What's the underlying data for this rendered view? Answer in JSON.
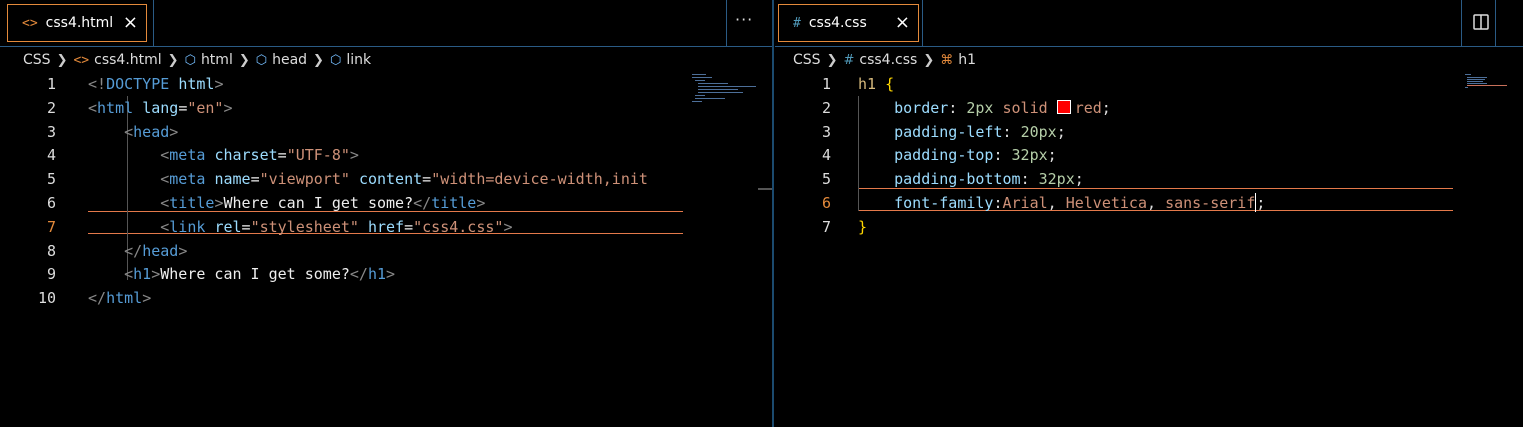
{
  "left": {
    "tab": {
      "icon": "<>",
      "label": "css4.html",
      "close": "×"
    },
    "more": "···",
    "breadcrumb": {
      "folder": "CSS",
      "file": "css4.html",
      "path": [
        "html",
        "head",
        "link"
      ]
    },
    "lines": [
      {
        "n": "1",
        "segs": [
          [
            "p",
            "<!"
          ],
          [
            "tag",
            "DOCTYPE"
          ],
          [
            "t",
            " "
          ],
          [
            "attr",
            "html"
          ],
          [
            "p",
            ">"
          ]
        ]
      },
      {
        "n": "2",
        "segs": [
          [
            "p",
            "<"
          ],
          [
            "tag",
            "html"
          ],
          [
            "t",
            " "
          ],
          [
            "attr",
            "lang"
          ],
          [
            "t",
            "="
          ],
          [
            "str",
            "\"en\""
          ],
          [
            "p",
            ">"
          ]
        ]
      },
      {
        "n": "3",
        "segs": [
          [
            "t",
            "    "
          ],
          [
            "p",
            "<"
          ],
          [
            "tag",
            "head"
          ],
          [
            "p",
            ">"
          ]
        ]
      },
      {
        "n": "4",
        "segs": [
          [
            "t",
            "        "
          ],
          [
            "p",
            "<"
          ],
          [
            "tag",
            "meta"
          ],
          [
            "t",
            " "
          ],
          [
            "attr",
            "charset"
          ],
          [
            "t",
            "="
          ],
          [
            "str",
            "\"UTF-8\""
          ],
          [
            "p",
            ">"
          ]
        ]
      },
      {
        "n": "5",
        "segs": [
          [
            "t",
            "        "
          ],
          [
            "p",
            "<"
          ],
          [
            "tag",
            "meta"
          ],
          [
            "t",
            " "
          ],
          [
            "attr",
            "name"
          ],
          [
            "t",
            "="
          ],
          [
            "str",
            "\"viewport\""
          ],
          [
            "t",
            " "
          ],
          [
            "attr",
            "content"
          ],
          [
            "t",
            "="
          ],
          [
            "str",
            "\"width=device-width,init"
          ]
        ]
      },
      {
        "n": "6",
        "segs": [
          [
            "t",
            "        "
          ],
          [
            "p",
            "<"
          ],
          [
            "tag",
            "title"
          ],
          [
            "p",
            ">"
          ],
          [
            "t",
            "Where can I get some?"
          ],
          [
            "p",
            "</"
          ],
          [
            "tag",
            "title"
          ],
          [
            "p",
            ">"
          ]
        ]
      },
      {
        "n": "7",
        "segs": [
          [
            "t",
            "        "
          ],
          [
            "p",
            "<"
          ],
          [
            "tag",
            "link"
          ],
          [
            "t",
            " "
          ],
          [
            "attr",
            "rel"
          ],
          [
            "t",
            "="
          ],
          [
            "str",
            "\"stylesheet\""
          ],
          [
            "t",
            " "
          ],
          [
            "attr",
            "href"
          ],
          [
            "t",
            "="
          ],
          [
            "str",
            "\"css4.css\""
          ],
          [
            "p",
            ">"
          ]
        ]
      },
      {
        "n": "8",
        "segs": [
          [
            "t",
            "    "
          ],
          [
            "p",
            "</"
          ],
          [
            "tag",
            "head"
          ],
          [
            "p",
            ">"
          ]
        ]
      },
      {
        "n": "9",
        "segs": [
          [
            "t",
            "    "
          ],
          [
            "p",
            "<"
          ],
          [
            "tag",
            "h1"
          ],
          [
            "p",
            ">"
          ],
          [
            "t",
            "Where can I get some?"
          ],
          [
            "p",
            "</"
          ],
          [
            "tag",
            "h1"
          ],
          [
            "p",
            ">"
          ]
        ]
      },
      {
        "n": "10",
        "segs": [
          [
            "p",
            "</"
          ],
          [
            "tag",
            "html"
          ],
          [
            "p",
            ">"
          ]
        ]
      }
    ]
  },
  "right": {
    "tab": {
      "icon": "#",
      "label": "css4.css",
      "close": "×"
    },
    "breadcrumb": {
      "folder": "CSS",
      "file": "css4.css",
      "selector": "h1"
    },
    "lines": [
      {
        "n": "1",
        "segs": [
          [
            "sel",
            "h1"
          ],
          [
            "t",
            " "
          ],
          [
            "brace",
            "{"
          ]
        ]
      },
      {
        "n": "2",
        "segs": [
          [
            "t",
            "    "
          ],
          [
            "prop",
            "border"
          ],
          [
            "punc",
            ": "
          ],
          [
            "num",
            "2px"
          ],
          [
            "t",
            " "
          ],
          [
            "val",
            "solid"
          ],
          [
            "t",
            " "
          ],
          [
            "swatch",
            ""
          ],
          [
            "val",
            "red"
          ],
          [
            "punc",
            ";"
          ]
        ]
      },
      {
        "n": "3",
        "segs": [
          [
            "t",
            "    "
          ],
          [
            "prop",
            "padding-left"
          ],
          [
            "punc",
            ": "
          ],
          [
            "num",
            "20px"
          ],
          [
            "punc",
            ";"
          ]
        ]
      },
      {
        "n": "4",
        "segs": [
          [
            "t",
            "    "
          ],
          [
            "prop",
            "padding-top"
          ],
          [
            "punc",
            ": "
          ],
          [
            "num",
            "32px"
          ],
          [
            "punc",
            ";"
          ]
        ]
      },
      {
        "n": "5",
        "segs": [
          [
            "t",
            "    "
          ],
          [
            "prop",
            "padding-bottom"
          ],
          [
            "punc",
            ": "
          ],
          [
            "num",
            "32px"
          ],
          [
            "punc",
            ";"
          ]
        ]
      },
      {
        "n": "6",
        "segs": [
          [
            "t",
            "    "
          ],
          [
            "prop",
            "font-family"
          ],
          [
            "punc",
            ":"
          ],
          [
            "val",
            "Arial"
          ],
          [
            "punc",
            ", "
          ],
          [
            "val",
            "Helvetica"
          ],
          [
            "punc",
            ", "
          ],
          [
            "val",
            "sans-serif"
          ],
          [
            "cursor",
            ""
          ],
          [
            "punc",
            ";"
          ]
        ]
      },
      {
        "n": "7",
        "segs": [
          [
            "brace",
            "}"
          ]
        ]
      }
    ]
  },
  "colors": {
    "accent": "#e48a3b",
    "border": "#2a5b85",
    "swatch": "#ff0000"
  }
}
